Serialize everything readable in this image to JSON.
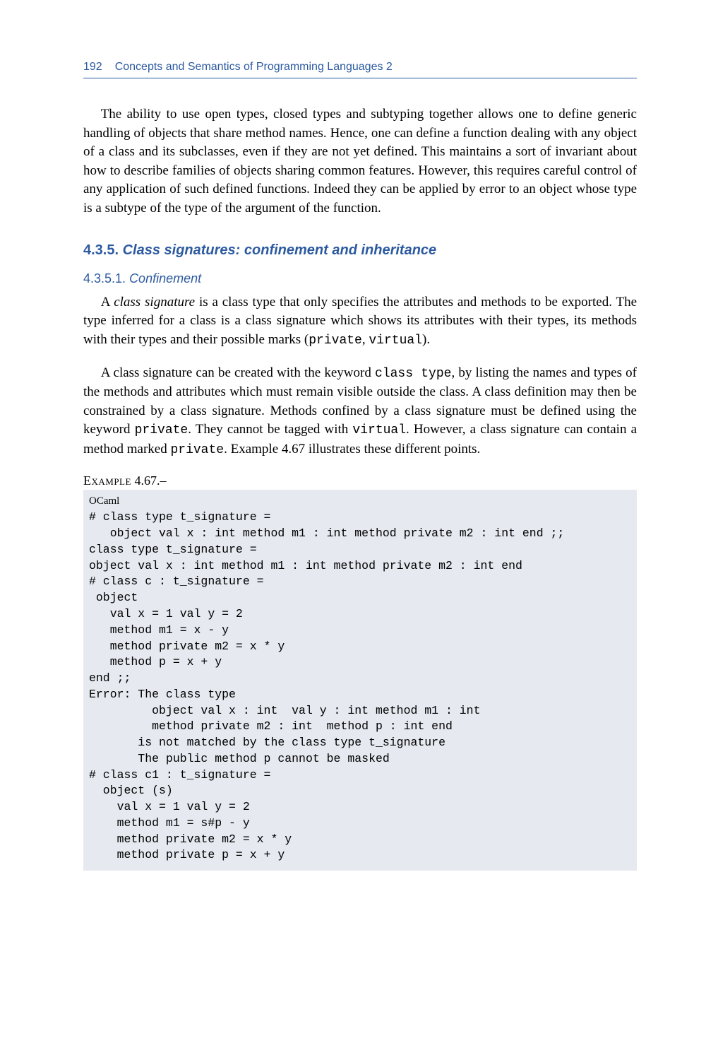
{
  "header": {
    "page_number": "192",
    "book_title": "Concepts and Semantics of Programming Languages 2"
  },
  "paragraphs": {
    "p1": "The ability to use open types, closed types and subtyping together allows one to define generic handling of objects that share method names. Hence, one can define a function dealing with any object of a class and its subclasses, even if they are not yet defined. This maintains a sort of invariant about how to describe families of objects sharing common features. However, this requires careful control of any application of such defined functions. Indeed they can be applied by error to an object whose type is a subtype of the type of the argument of the function."
  },
  "section": {
    "number": "4.3.5.",
    "title": "Class signatures: confinement and inheritance"
  },
  "subsection": {
    "number": "4.3.5.1.",
    "title": "Confinement"
  },
  "conf": {
    "p1_a": "A ",
    "p1_emph": "class signature",
    "p1_b": " is a class type that only specifies the attributes and methods to be exported. The type inferred for a class is a class signature which shows its attributes with their types, its methods with their types and their possible marks (",
    "p1_code1": "private",
    "p1_c": ", ",
    "p1_code2": "virtual",
    "p1_d": ").",
    "p2_a": "A class signature can be created with the keyword ",
    "p2_code1": "class type",
    "p2_b": ", by listing the names and types of the methods and attributes which must remain visible outside the class. A class definition may then be constrained by a class signature. Methods confined by a class signature must be defined using the keyword ",
    "p2_code2": "private",
    "p2_c": ". They cannot be tagged with ",
    "p2_code3": "virtual",
    "p2_d": ". However, a class signature can contain a method marked ",
    "p2_code4": "private",
    "p2_e": ". Example 4.67 illustrates these different points."
  },
  "example": {
    "label_sc": "Example",
    "label_num": " 4.67.–",
    "lang": "OCaml",
    "code": "# class type t_signature =\n   object val x : int method m1 : int method private m2 : int end ;;\nclass type t_signature =\nobject val x : int method m1 : int method private m2 : int end\n# class c : t_signature =\n object\n   val x = 1 val y = 2\n   method m1 = x - y\n   method private m2 = x * y\n   method p = x + y\nend ;;\nError: The class type\n         object val x : int  val y : int method m1 : int\n         method private m2 : int  method p : int end\n       is not matched by the class type t_signature\n       The public method p cannot be masked\n# class c1 : t_signature =\n  object (s)\n    val x = 1 val y = 2\n    method m1 = s#p - y\n    method private m2 = x * y\n    method private p = x + y"
  }
}
